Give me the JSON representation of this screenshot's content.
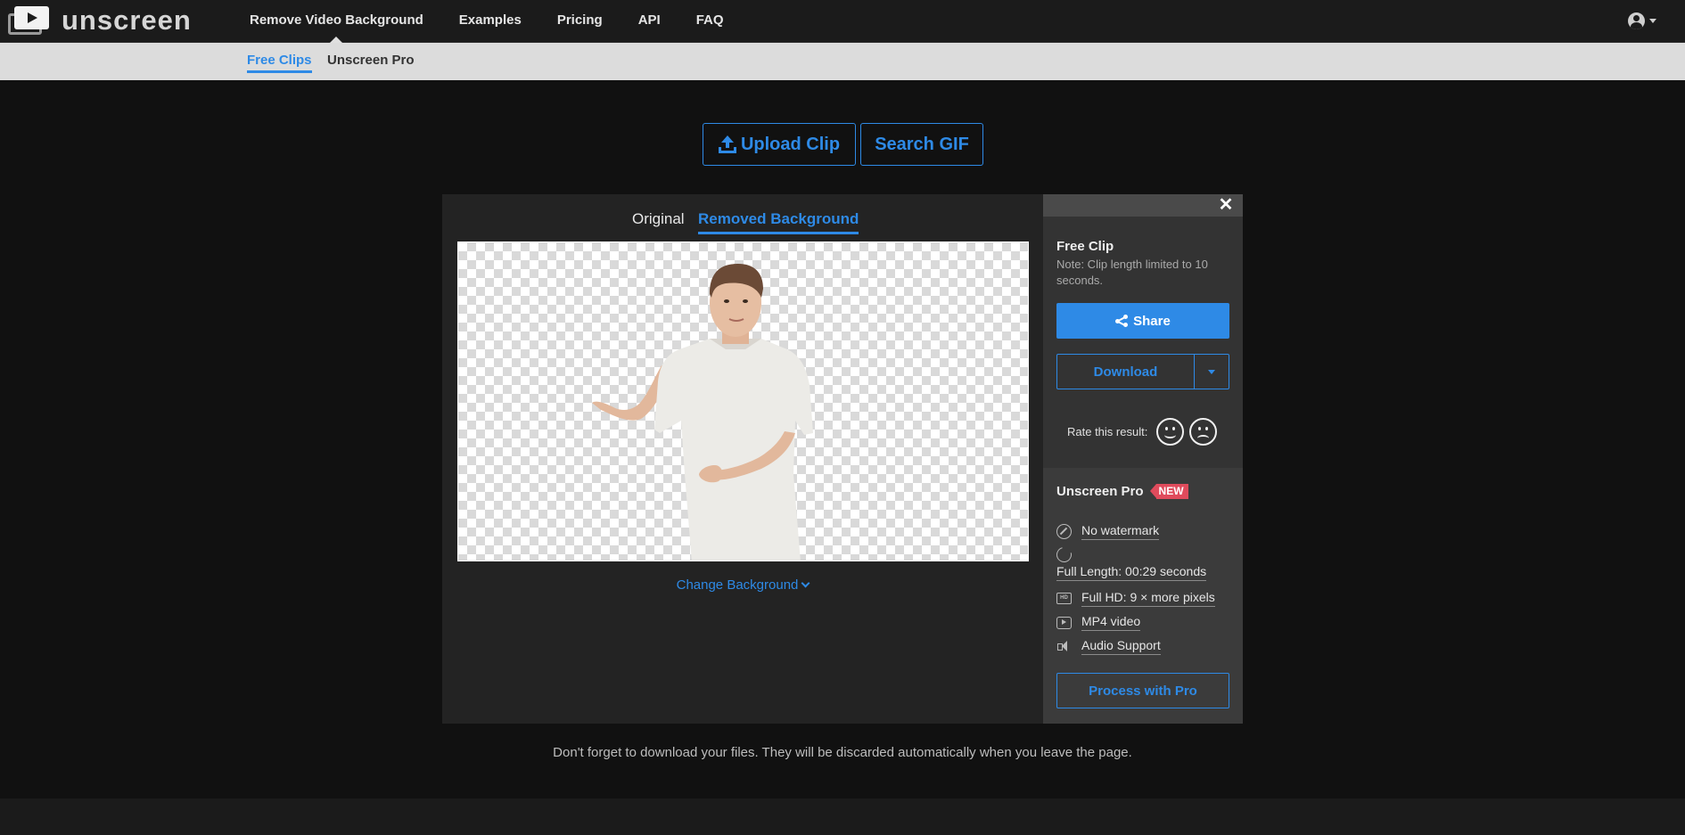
{
  "logo": {
    "text": "unscreen"
  },
  "nav": {
    "links": [
      "Remove Video Background",
      "Examples",
      "Pricing",
      "API",
      "FAQ"
    ],
    "active": "Remove Video Background",
    "account_icon": "user-circle-icon"
  },
  "subnav": {
    "tabs": [
      "Free Clips",
      "Unscreen Pro"
    ],
    "active": "Free Clips"
  },
  "actions": {
    "upload_label": "Upload Clip",
    "search_label": "Search GIF"
  },
  "editor": {
    "tabs": [
      "Original",
      "Removed Background"
    ],
    "active_tab": "Removed Background",
    "change_bg_label": "Change Background"
  },
  "sidebar": {
    "close_icon": "close-icon",
    "title": "Free Clip",
    "note": "Note: Clip length limited to 10 seconds.",
    "share_label": "Share",
    "download_label": "Download",
    "rate_label": "Rate this result:",
    "pro": {
      "title": "Unscreen Pro",
      "badge": "NEW",
      "features": [
        {
          "icon": "no-watermark-icon",
          "text": "No watermark"
        },
        {
          "icon": "length-icon",
          "text": "Full Length: 00:29 seconds"
        },
        {
          "icon": "hd-icon",
          "text": "Full HD: 9 × more pixels"
        },
        {
          "icon": "video-file-icon",
          "text": "MP4 video"
        },
        {
          "icon": "audio-icon",
          "text": "Audio Support"
        }
      ],
      "process_label": "Process with Pro"
    }
  },
  "footnote": "Don't forget to download your files. They will be discarded automatically when you leave the page.",
  "colors": {
    "accent": "#2e8ae6",
    "badge": "#e04b5c",
    "background": "#111111"
  }
}
